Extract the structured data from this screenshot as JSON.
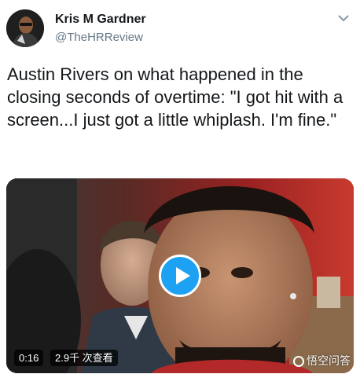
{
  "author": {
    "display_name": "Kris M Gardner",
    "handle": "@TheHRReview",
    "avatar_icon": "person-avatar"
  },
  "header": {
    "menu_icon": "chevron-down-icon"
  },
  "tweet": {
    "text": "Austin Rivers on what happened in the closing seconds of overtime: \"I got hit with a screen...I just got a little whiplash. I'm fine.\""
  },
  "media": {
    "type": "video",
    "duration": "0:16",
    "views": "2.9千 次查看",
    "play_icon": "play-icon",
    "watermark": "悟空问答"
  },
  "colors": {
    "accent": "#1da1f2",
    "handle": "#657786",
    "text": "#14171a"
  }
}
